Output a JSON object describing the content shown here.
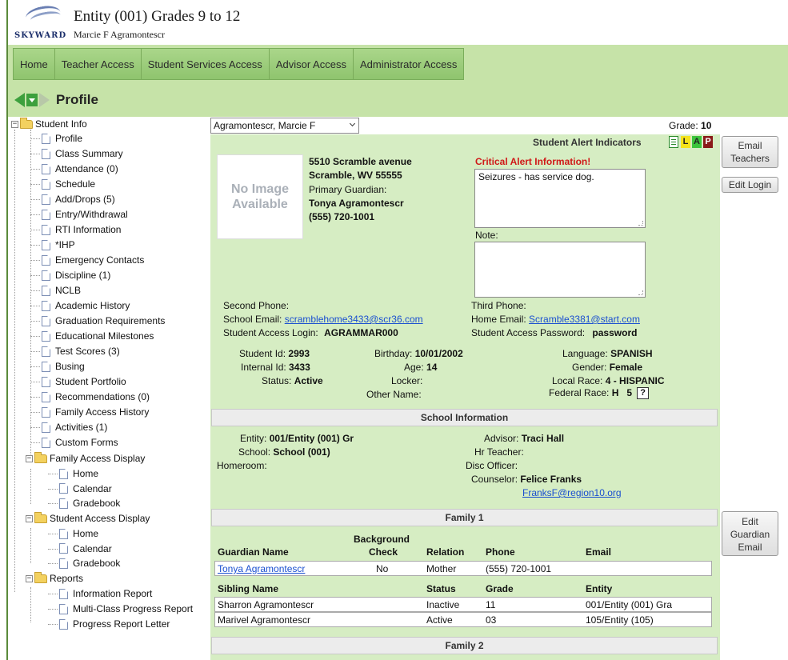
{
  "header": {
    "logo_text": "SKYWARD",
    "title": "Entity (001) Grades 9 to 12",
    "user": "Marcie F Agramontescr"
  },
  "nav": {
    "tabs": [
      "Home",
      "Teacher Access",
      "Student Services Access",
      "Advisor Access",
      "Administrator Access"
    ]
  },
  "page": {
    "title": "Profile"
  },
  "tree": {
    "student_info": "Student Info",
    "items": [
      "Profile",
      "Class Summary",
      "Attendance (0)",
      "Schedule",
      "Add/Drops (5)",
      "Entry/Withdrawal",
      "RTI Information",
      "*IHP",
      "Emergency Contacts",
      "Discipline (1)",
      "NCLB",
      "Academic History",
      "Graduation Requirements",
      "Educational Milestones",
      "Test Scores (3)",
      "Busing",
      "Student Portfolio",
      "Recommendations (0)",
      "Family Access History",
      "Activities (1)",
      "Custom Forms"
    ],
    "family_access_display": "Family Access Display",
    "family_items": [
      "Home",
      "Calendar",
      "Gradebook"
    ],
    "student_access_display": "Student Access Display",
    "student_items": [
      "Home",
      "Calendar",
      "Gradebook"
    ],
    "reports": "Reports",
    "report_items": [
      "Information Report",
      "Multi-Class Progress Report",
      "Progress Report Letter"
    ]
  },
  "student": {
    "selected": "Agramontescr, Marcie F",
    "grade_label": "Grade:",
    "grade": "10",
    "alert_indicators_label": "Student Alert Indicators",
    "indicators": [
      "L",
      "A",
      "P"
    ],
    "photo_text_1": "No Image",
    "photo_text_2": "Available",
    "address1": "5510 Scramble avenue",
    "address2": "Scramble, WV 55555",
    "primary_guardian_label": "Primary Guardian:",
    "primary_guardian": "Tonya Agramontescr",
    "phone": "(555) 720-1001",
    "critical_alert_label": "Critical Alert Information!",
    "critical_alert": "Seizures - has service dog.",
    "note_label": "Note:",
    "note": "",
    "second_phone_label": "Second Phone:",
    "third_phone_label": "Third Phone:",
    "school_email_label": "School Email:",
    "school_email": "scramblehome3433@scr36.com",
    "home_email_label": "Home Email:",
    "home_email": "Scramble3381@start.com",
    "access_login_label": "Student Access Login:",
    "access_login": "AGRAMMAR000",
    "access_password_label": "Student Access Password:",
    "access_password": "password",
    "student_id_label": "Student Id:",
    "student_id": "2993",
    "internal_id_label": "Internal Id:",
    "internal_id": "3433",
    "status_label": "Status:",
    "status": "Active",
    "birthday_label": "Birthday:",
    "birthday": "10/01/2002",
    "age_label": "Age:",
    "age": "14",
    "locker_label": "Locker:",
    "other_name_label": "Other Name:",
    "language_label": "Language:",
    "language": "SPANISH",
    "gender_label": "Gender:",
    "gender": "Female",
    "local_race_label": "Local Race:",
    "local_race": "4 - HISPANIC",
    "federal_race_label": "Federal Race:",
    "federal_race": "H   5",
    "help": "?"
  },
  "school_info": {
    "title": "School Information",
    "entity_label": "Entity:",
    "entity": "001/Entity (001) Gr",
    "school_label": "School:",
    "school": "School (001)",
    "homeroom_label": "Homeroom:",
    "advisor_label": "Advisor:",
    "advisor": "Traci Hall",
    "hr_teacher_label": "Hr Teacher:",
    "disc_officer_label": "Disc Officer:",
    "counselor_label": "Counselor:",
    "counselor": "Felice Franks",
    "counselor_email": "FranksF@region10.org"
  },
  "family1": {
    "title": "Family 1",
    "guardian_headers": [
      "Guardian Name",
      "Background",
      "Check",
      "Relation",
      "Phone",
      "Email"
    ],
    "guardians": [
      {
        "name": "Tonya Agramontescr",
        "check": "No",
        "relation": "Mother",
        "phone": "(555) 720-1001",
        "email": ""
      }
    ],
    "sibling_headers": [
      "Sibling Name",
      "Status",
      "Grade",
      "Entity"
    ],
    "siblings": [
      {
        "name": "Sharron Agramontescr",
        "status": "Inactive",
        "grade": "11",
        "entity": "001/Entity (001) Gra"
      },
      {
        "name": "Marivel Agramontescr",
        "status": "Active",
        "grade": "03",
        "entity": "105/Entity (105)"
      }
    ]
  },
  "family2": {
    "title": "Family 2"
  },
  "buttons": {
    "email_teachers_1": "Email",
    "email_teachers_2": "Teachers",
    "edit_login": "Edit Login",
    "edit_guardian_1": "Edit",
    "edit_guardian_2": "Guardian",
    "edit_guardian_3": "Email"
  },
  "colors": {
    "band": "#c6e3a8",
    "panel": "#d6edc3",
    "alert_red": "#d01818",
    "indicator_L": "#f5e31a",
    "indicator_A": "#3cc43c",
    "indicator_P": "#8a1a1a"
  }
}
